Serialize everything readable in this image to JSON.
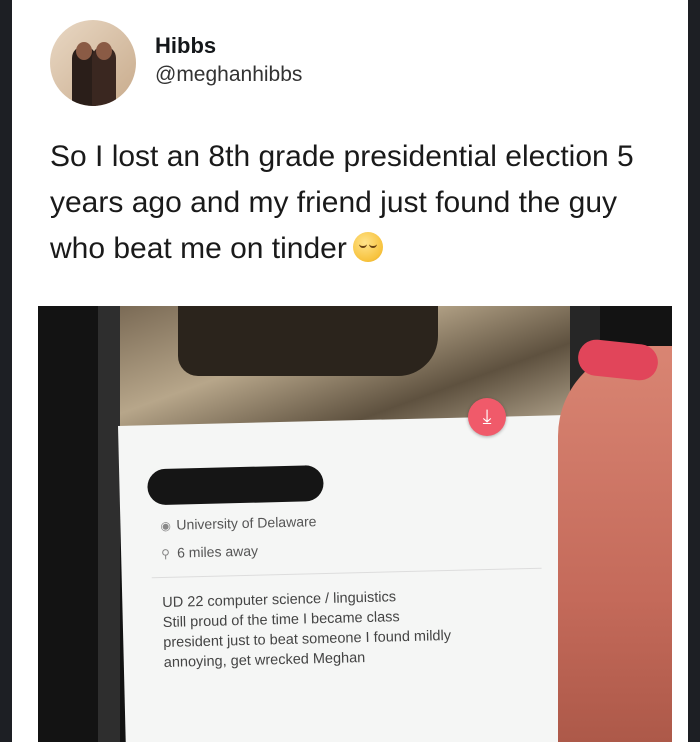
{
  "tweet": {
    "author_name": "Hibbs",
    "author_handle": "@meghanhibbs",
    "text": "So I lost an 8th grade presidential election 5 years ago and my friend just found the guy who beat me on tinder",
    "emoji": "relieved-face"
  },
  "profile": {
    "school": "University of Delaware",
    "distance": "6 miles away",
    "bio_lines": [
      "UD 22 computer science / linguistics",
      "Still proud of the time I became class",
      "president just to beat someone I found mildly",
      "annoying, get wrecked Meghan"
    ]
  },
  "colors": {
    "background": "#1d1f24",
    "card": "#ffffff",
    "tinder_button": "#f05a6a"
  }
}
